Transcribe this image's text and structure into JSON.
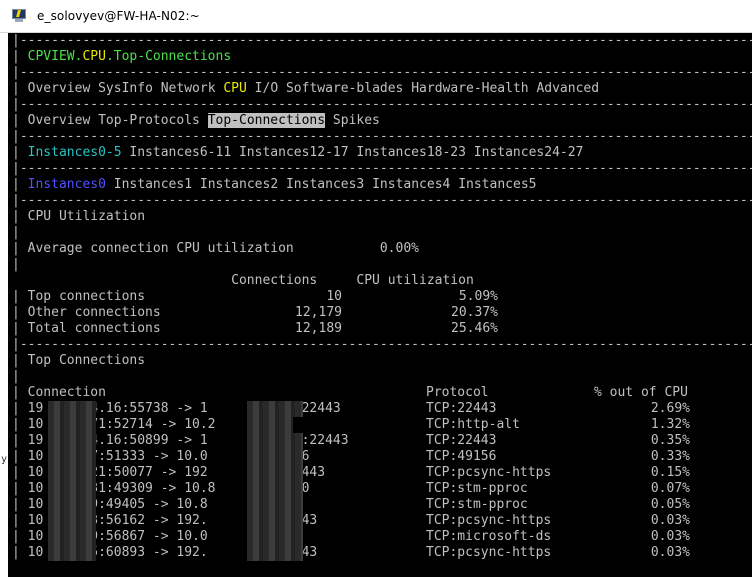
{
  "window": {
    "title": "e_solovyev@FW-HA-N02:~"
  },
  "colors": {
    "terminal_bg": "#000000",
    "text": "#c0c0c0",
    "green": "#4be04b",
    "yellow": "#e8e800",
    "cyan": "#27c3c3",
    "blue": "#5050ff",
    "highlight_bg": "#c0c0c0"
  },
  "icons": {
    "app": "putty-terminal-icon"
  },
  "border_line": "|---------------------------------------------------------------------------------------------------------------------------------------|",
  "breadcrumb": {
    "p1": "CPVIEW.",
    "p2": "CPU",
    "p3": ".",
    "p4": "Top-Connections"
  },
  "menu": {
    "overview": "Overview",
    "sysinfo": "SysInfo",
    "network": "Network",
    "cpu": "CPU",
    "io": "I/O",
    "software_blades": "Software-blades",
    "hardware_health": "Hardware-Health",
    "advanced": "Advanced"
  },
  "submenu": {
    "overview": "Overview",
    "top_protocols": "Top-Protocols",
    "top_connections": "Top-Connections",
    "spikes": "Spikes"
  },
  "instance_groups": [
    "Instances0-5",
    "Instances6-11",
    "Instances12-17",
    "Instances18-23",
    "Instances24-27"
  ],
  "instances": [
    "Instances0",
    "Instances1",
    "Instances2",
    "Instances3",
    "Instances4",
    "Instances5"
  ],
  "cpu_util": {
    "heading": "CPU Utilization",
    "avg_label": "Average connection CPU utilization",
    "avg_value": "0.00%",
    "col_connections": "Connections",
    "col_cpu": "CPU utilization",
    "rows": [
      {
        "label": "Top connections",
        "connections": "10",
        "cpu": "5.09%"
      },
      {
        "label": "Other connections",
        "connections": "12,179",
        "cpu": "20.37%"
      },
      {
        "label": "Total connections",
        "connections": "12,189",
        "cpu": "25.46%"
      }
    ]
  },
  "top_connections": {
    "heading": "Top Connections",
    "col_connection": "Connection",
    "col_protocol": "Protocol",
    "col_pct": "% out of CPU",
    "rows": [
      {
        "connection": "19      4.16:55738 -> 1       .170:22443",
        "protocol": "TCP:22443",
        "pct": "2.69%"
      },
      {
        "connection": "10      71:52714 -> 10.2      8080",
        "protocol": "TCP:http-alt",
        "pct": "1.32%"
      },
      {
        "connection": "19      4.16:50899 -> 1      54.109:22443",
        "protocol": "TCP:22443",
        "pct": "0.35%"
      },
      {
        "connection": "10      7:51333 -> 10.0      1:49156",
        "protocol": "TCP:49156",
        "pct": "0.33%"
      },
      {
        "connection": "10      21:50077 -> 192      4.16:8443",
        "protocol": "TCP:pcsync-https",
        "pct": "0.15%"
      },
      {
        "connection": "10      31:49309 -> 10.8      2:3080",
        "protocol": "TCP:stm-pproc",
        "pct": "0.07%"
      },
      {
        "connection": "10      9:49405 -> 10.8      :3080",
        "protocol": "TCP:stm-pproc",
        "pct": "0.05%"
      },
      {
        "connection": "10      3:56162 -> 192.      .16:8443",
        "protocol": "TCP:pcsync-https",
        "pct": "0.03%"
      },
      {
        "connection": "10      9:56867 -> 10.0      :445",
        "protocol": "TCP:microsoft-ds",
        "pct": "0.03%"
      },
      {
        "connection": "10      5:60893 -> 192.      .16:8443",
        "protocol": "TCP:pcsync-https",
        "pct": "0.03%"
      }
    ]
  }
}
